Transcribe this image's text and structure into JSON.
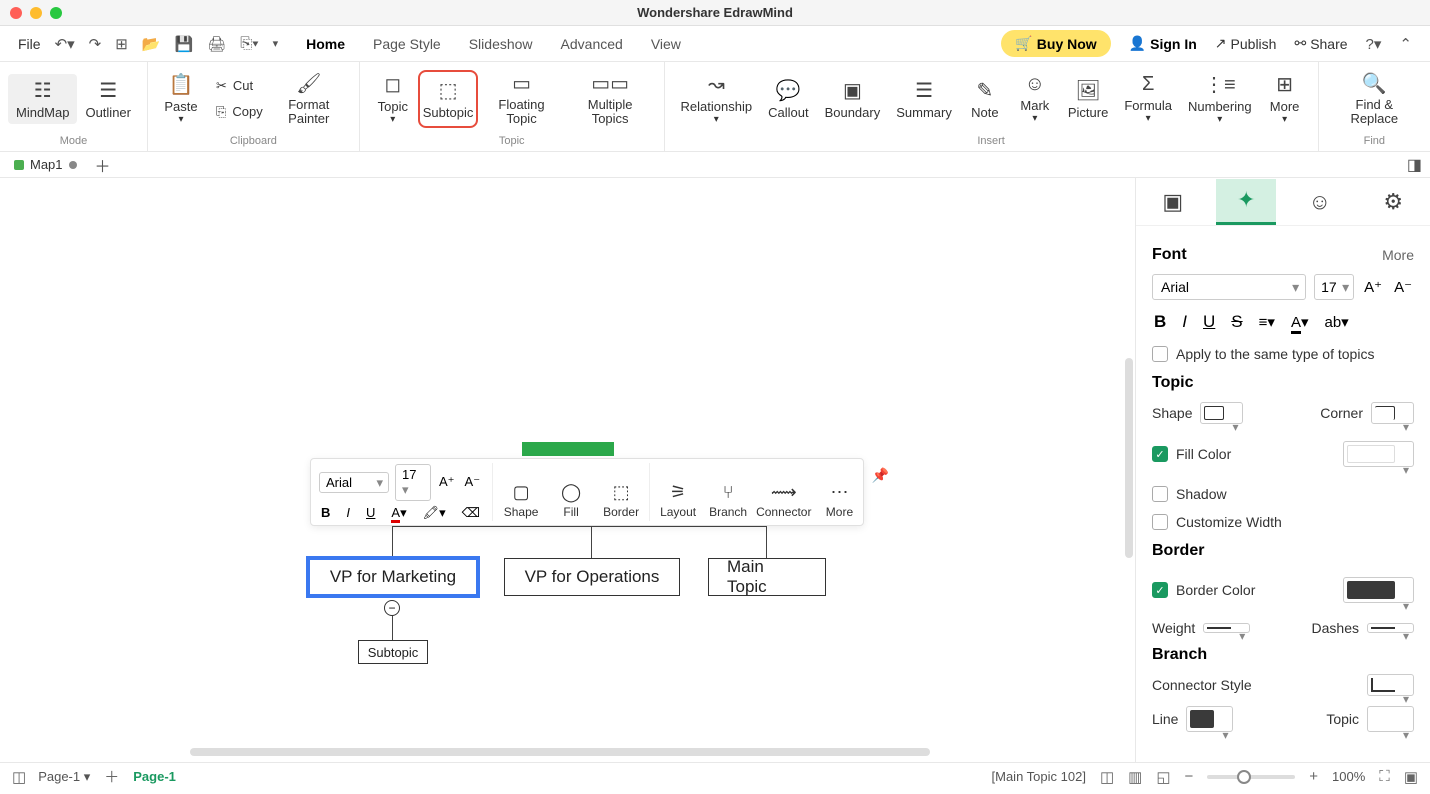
{
  "app_title": "Wondershare EdrawMind",
  "menubar": {
    "file": "File",
    "tabs": [
      "Home",
      "Page Style",
      "Slideshow",
      "Advanced",
      "View"
    ],
    "active_tab": 0,
    "buy_now": "Buy Now",
    "sign_in": "Sign In",
    "publish": "Publish",
    "share": "Share"
  },
  "ribbon": {
    "mode": {
      "mindmap": "MindMap",
      "outliner": "Outliner",
      "label": "Mode"
    },
    "clipboard": {
      "paste": "Paste",
      "cut": "Cut",
      "copy": "Copy",
      "format_painter": "Format Painter",
      "label": "Clipboard"
    },
    "topic": {
      "topic": "Topic",
      "subtopic": "Subtopic",
      "floating": "Floating Topic",
      "multiple": "Multiple Topics",
      "label": "Topic"
    },
    "insert": {
      "relationship": "Relationship",
      "callout": "Callout",
      "boundary": "Boundary",
      "summary": "Summary",
      "note": "Note",
      "mark": "Mark",
      "picture": "Picture",
      "formula": "Formula",
      "numbering": "Numbering",
      "more": "More",
      "label": "Insert"
    },
    "find": {
      "find_replace": "Find & Replace",
      "label": "Find"
    }
  },
  "doctab": {
    "name": "Map1"
  },
  "canvas": {
    "nodes": {
      "vp_marketing": "VP for Marketing",
      "vp_operations": "VP for Operations",
      "main_topic": "Main Topic",
      "subtopic": "Subtopic"
    },
    "collapse_symbol": "−"
  },
  "float_toolbar": {
    "font": "Arial",
    "size": "17",
    "shape": "Shape",
    "fill": "Fill",
    "border": "Border",
    "layout": "Layout",
    "branch": "Branch",
    "connector": "Connector",
    "more": "More"
  },
  "sidepanel": {
    "font": {
      "title": "Font",
      "more": "More",
      "family": "Arial",
      "size": "17",
      "apply_same": "Apply to the same type of topics"
    },
    "topic": {
      "title": "Topic",
      "shape": "Shape",
      "corner": "Corner",
      "fill_color": "Fill Color",
      "shadow": "Shadow",
      "customize_width": "Customize Width"
    },
    "border": {
      "title": "Border",
      "border_color": "Border Color",
      "weight": "Weight",
      "dashes": "Dashes",
      "color": "#3a3a3a"
    },
    "branch": {
      "title": "Branch",
      "connector_style": "Connector Style",
      "line": "Line",
      "topic": "Topic",
      "line_color": "#3a3a3a"
    }
  },
  "statusbar": {
    "page_label": "Page-1",
    "page_tab": "Page-1",
    "selection": "[Main Topic 102]",
    "zoom": "100%"
  }
}
